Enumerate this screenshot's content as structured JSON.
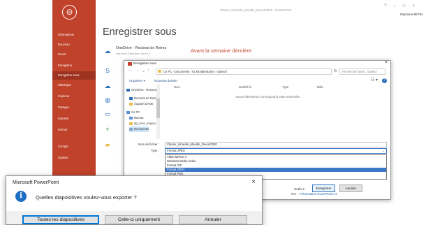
{
  "powerpoint": {
    "window_title": "Classe_Virtuelle_Moodle_Devoir2020 - PowerPoint",
    "account": "Stephane BETIN",
    "back_glyph": "⊖",
    "page_title": "Enregistrer sous",
    "sidebar": [
      {
        "label": "Informations"
      },
      {
        "label": "Nouveau"
      },
      {
        "label": "Ouvrir"
      },
      {
        "label": "Enregistrer"
      },
      {
        "label": "Enregistrer sous",
        "active": true
      },
      {
        "label": "Historique"
      },
      {
        "label": "Imprimer"
      },
      {
        "label": "Partager"
      },
      {
        "label": "Exporter"
      },
      {
        "label": "Fermer"
      },
      {
        "label": "Compte"
      },
      {
        "label": "Options"
      }
    ],
    "recent_places": [
      {
        "label": "OneDrive - Rectorat de Reims",
        "sub": "stephane.betin@ac-reims.fr",
        "icon": "cloud-icon"
      },
      {
        "label": "",
        "sub": "",
        "icon": "sharepoint-icon"
      },
      {
        "label": "",
        "sub": "",
        "icon": "cloud-icon"
      },
      {
        "label": "",
        "sub": "",
        "icon": "globe-icon"
      },
      {
        "label": "",
        "sub": "",
        "icon": "pc-icon"
      },
      {
        "label": "",
        "sub": "",
        "icon": "add-place-icon"
      },
      {
        "label": "",
        "sub": "",
        "icon": "folder-icon"
      }
    ],
    "recent_header": "Avant la semaine dernière"
  },
  "saveas": {
    "title": "Enregistrer sous",
    "path": "Ce PC  ›  Documents  ›  01 MoodleStarter  ›  classe2",
    "search_placeholder": "Rechercher dans : classe2",
    "organize_label": "Organiser ▾",
    "new_folder_label": "Nouveau dossier",
    "nav_items": [
      {
        "label": "OneDrive - Rectora",
        "color": "#2d6fb8"
      },
      {
        "label": "Rectorat de Reims",
        "color": "#2d6fb8"
      },
      {
        "label": "Support DANE",
        "color": "#e8bd4c"
      },
      {
        "label": "Ce PC",
        "color": "#5a8fd0"
      },
      {
        "label": "Bureau",
        "color": "#5a8fd0"
      },
      {
        "label": "dg_conc_mayou",
        "color": "#e8bd4c"
      },
      {
        "label": "Documents",
        "color": "#8aa6c8",
        "selected": true
      }
    ],
    "columns": [
      "Nom",
      "Modifié le",
      "Type",
      "Taille"
    ],
    "empty_message": "Aucun élément ne correspond à votre recherche.",
    "filename_label": "Nom de fichier :",
    "filename_value": "Classe_Virtuelle_Moodle_Devoir2020",
    "filetype_label": "Type :",
    "filetype_value": "Format JPEG",
    "filetype_options": [
      {
        "label": "Vidéo MPEG-4"
      },
      {
        "label": "Windows Media Video"
      },
      {
        "label": "Format GIF"
      },
      {
        "label": "Format JPEG",
        "selected": true
      },
      {
        "label": "Format PNG"
      },
      {
        "label": "Format TIFF"
      }
    ],
    "authors_label": "Titre :",
    "authors_value": "Présentation PowerPoint A4",
    "tools_label": "Outils  ▾",
    "save_label": "Enregistrer",
    "cancel_label": "Annuler"
  },
  "message_box": {
    "title": "Microsoft PowerPoint",
    "text": "Quelles diapositives voulez-vous exporter ?",
    "buttons": [
      {
        "label": "Toutes les diapositives",
        "default": true
      },
      {
        "label": "Celle-ci uniquement",
        "default": false
      },
      {
        "label": "Annuler",
        "default": false
      }
    ]
  }
}
